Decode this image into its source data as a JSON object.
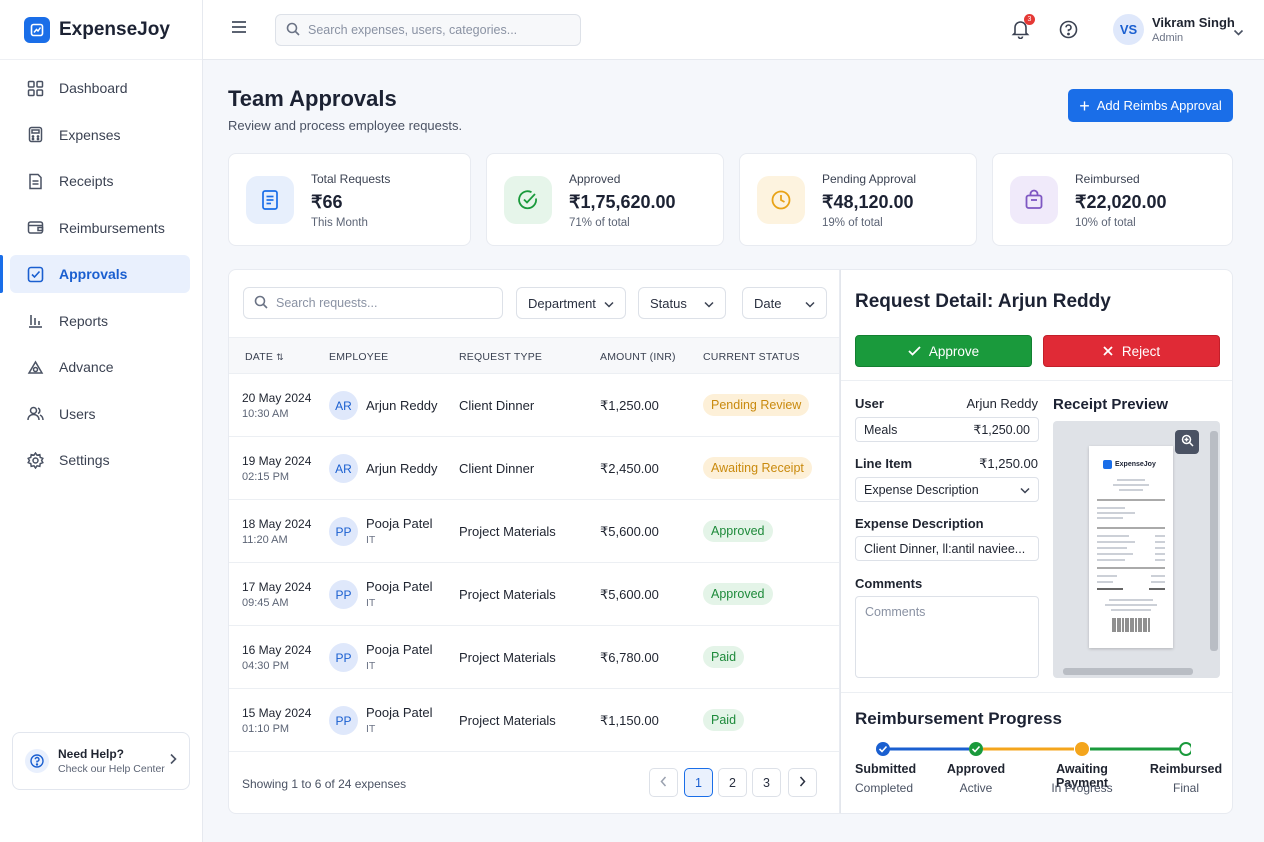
{
  "app": {
    "name": "ExpenseJoy"
  },
  "sidebar": {
    "items": [
      {
        "label": "Dashboard",
        "icon": "grid-icon"
      },
      {
        "label": "Expenses",
        "icon": "calculator-icon"
      },
      {
        "label": "Receipts",
        "icon": "receipt-icon"
      },
      {
        "label": "Reimbursements",
        "icon": "wallet-icon"
      },
      {
        "label": "Approvals",
        "icon": "check-square-icon",
        "active": true
      },
      {
        "label": "Reports",
        "icon": "bar-chart-icon"
      },
      {
        "label": "Advance",
        "icon": "advance-icon"
      },
      {
        "label": "Users",
        "icon": "users-icon"
      },
      {
        "label": "Settings",
        "icon": "gear-icon"
      }
    ],
    "help": {
      "title": "Need Help?",
      "subtitle": "Check our Help Center"
    }
  },
  "topbar": {
    "search_placeholder": "Search expenses, users, categories...",
    "notification_count": "3",
    "user": {
      "initials": "VS",
      "name": "Vikram Singh",
      "role": "Admin"
    }
  },
  "page": {
    "title": "Team Approvals",
    "subtitle": "Review and process employee requests.",
    "add_button": "Add Reimbs Approval"
  },
  "stats": [
    {
      "label": "Total Requests",
      "value": "₹66",
      "note": "This Month",
      "color": "#1a6ee8"
    },
    {
      "label": "Approved",
      "value": "₹1,75,620.00",
      "note": "71% of total",
      "color": "#1a9a3c"
    },
    {
      "label": "Pending Approval",
      "value": "₹48,120.00",
      "note": "19% of total",
      "color": "#e8a317"
    },
    {
      "label": "Reimbursed",
      "value": "₹22,020.00",
      "note": "10% of total",
      "color": "#7e57c2"
    }
  ],
  "table": {
    "search_placeholder": "Search requests...",
    "filters": [
      "Department",
      "Status",
      "Date"
    ],
    "columns": [
      "DATE",
      "EMPLOYEE",
      "REQUEST TYPE",
      "AMOUNT (INR)",
      "CURRENT STATUS"
    ],
    "rows": [
      {
        "date": "20 May 2024",
        "time": "10:30 AM",
        "initials": "AR",
        "name": "Arjun Reddy",
        "dept": "",
        "type": "Client Dinner",
        "amount": "₹1,250.00",
        "status": "Pending Review",
        "status_kind": "pending"
      },
      {
        "date": "19 May 2024",
        "time": "02:15 PM",
        "initials": "AR",
        "name": "Arjun Reddy",
        "dept": "",
        "type": "Client Dinner",
        "amount": "₹2,450.00",
        "status": "Awaiting Receipt",
        "status_kind": "pending"
      },
      {
        "date": "18 May 2024",
        "time": "11:20 AM",
        "initials": "PP",
        "name": "Pooja Patel",
        "dept": "IT",
        "type": "Project Materials",
        "amount": "₹5,600.00",
        "status": "Approved",
        "status_kind": "approved"
      },
      {
        "date": "17 May 2024",
        "time": "09:45 AM",
        "initials": "PP",
        "name": "Pooja Patel",
        "dept": "IT",
        "type": "Project Materials",
        "amount": "₹5,600.00",
        "status": "Approved",
        "status_kind": "approved"
      },
      {
        "date": "16 May 2024",
        "time": "04:30 PM",
        "initials": "PP",
        "name": "Pooja Patel",
        "dept": "IT",
        "type": "Project Materials",
        "amount": "₹6,780.00",
        "status": "Paid",
        "status_kind": "approved"
      },
      {
        "date": "15 May 2024",
        "time": "01:10 PM",
        "initials": "PP",
        "name": "Pooja Patel",
        "dept": "IT",
        "type": "Project Materials",
        "amount": "₹1,150.00",
        "status": "Paid",
        "status_kind": "approved"
      }
    ],
    "showing": "Showing 1 to 6 of 24 expenses",
    "pages": [
      "1",
      "2",
      "3"
    ],
    "current_page": "1"
  },
  "detail": {
    "title": "Request Detail: Arjun Reddy",
    "approve_label": "Approve",
    "reject_label": "Reject",
    "user_label": "User",
    "user_value": "Arjun Reddy",
    "category_value": "Meals",
    "category_amount": "₹1,250.00",
    "line_item_label": "Line Item",
    "line_item_amount": "₹1,250.00",
    "line_item_select": "Expense Description",
    "expense_desc_label": "Expense Description",
    "expense_desc_value": "Client Dinner, ll:antil naviee...",
    "comments_label": "Comments",
    "comments_placeholder": "Comments",
    "receipt_preview_title": "Receipt Preview",
    "receipt_brand": "ExpenseJoy",
    "progress_title": "Reimbursement Progress",
    "steps": [
      {
        "label": "Submitted",
        "sub": "Completed",
        "state": "done",
        "color": "#1a5fd0"
      },
      {
        "label": "Approved",
        "sub": "Active",
        "state": "done",
        "color": "#1a9a3c"
      },
      {
        "label": "Awaiting Payment",
        "sub": "In Progress",
        "state": "current",
        "color": "#f4a51c"
      },
      {
        "label": "Reimbursed",
        "sub": "Final",
        "state": "todo",
        "color": "#1a9a3c"
      }
    ]
  }
}
